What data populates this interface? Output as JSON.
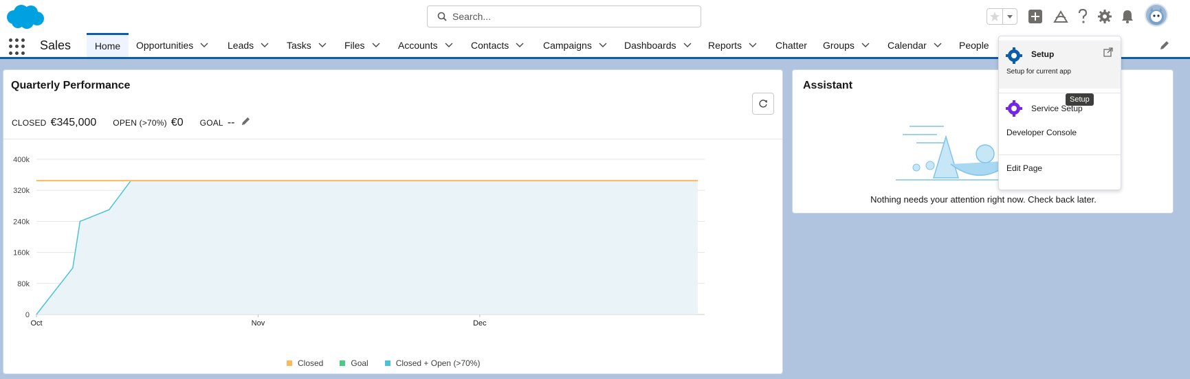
{
  "header": {
    "search_placeholder": "Search...",
    "icons": [
      "salesforce-cloud-logo",
      "star-icon",
      "chevron-down-icon",
      "add-icon",
      "trailhead-icon",
      "help-icon",
      "gear-icon",
      "bell-icon",
      "avatar"
    ]
  },
  "nav": {
    "app_name": "Sales",
    "items": [
      {
        "label": "Home"
      },
      {
        "label": "Opportunities"
      },
      {
        "label": "Leads"
      },
      {
        "label": "Tasks"
      },
      {
        "label": "Files"
      },
      {
        "label": "Accounts"
      },
      {
        "label": "Contacts"
      },
      {
        "label": "Campaigns"
      },
      {
        "label": "Dashboards"
      },
      {
        "label": "Reports"
      },
      {
        "label": "Chatter"
      },
      {
        "label": "Groups"
      },
      {
        "label": "Calendar"
      },
      {
        "label": "People"
      }
    ]
  },
  "quarterly": {
    "title": "Quarterly Performance",
    "closed_label": "CLOSED",
    "closed_value": "€345,000",
    "open_label": "OPEN (>70%)",
    "open_value": "€0",
    "goal_label": "GOAL",
    "goal_value": "--"
  },
  "chart_data": {
    "type": "area",
    "title": "",
    "xlabel": "",
    "ylabel": "",
    "y_ticks": [
      "400k",
      "320k",
      "240k",
      "160k",
      "80k",
      "0"
    ],
    "x_ticks": [
      "Oct",
      "Nov",
      "Dec"
    ],
    "ylim": [
      0,
      400000
    ],
    "x_days_range": [
      0,
      91
    ],
    "grid": true,
    "legend_position": "bottom",
    "series": [
      {
        "name": "Closed",
        "color": "#fcb95b",
        "x": [
          0,
          91
        ],
        "values": [
          345000,
          345000
        ]
      },
      {
        "name": "Goal",
        "color": "#4bca81",
        "x": [],
        "values": []
      },
      {
        "name": "Closed + Open (>70%)",
        "color": "#4bc3d7",
        "x": [
          0,
          5,
          6,
          10,
          13,
          91
        ],
        "values": [
          0,
          120000,
          240000,
          270000,
          345000,
          345000
        ]
      }
    ]
  },
  "legend": [
    "Closed",
    "Goal",
    "Closed + Open (>70%)"
  ],
  "assistant": {
    "title": "Assistant",
    "message": "Nothing needs your attention right now. Check back later."
  },
  "setup_menu": {
    "setup_title": "Setup",
    "setup_sub": "Setup for current app",
    "service_setup": "Service Setup",
    "developer_console": "Developer Console",
    "edit_page": "Edit Page",
    "tooltip": "Setup"
  },
  "colors": {
    "brand_blue": "#0b5cab",
    "closed": "#fcb95b",
    "goal": "#4bca81",
    "closed_open": "#4bc3d7"
  }
}
